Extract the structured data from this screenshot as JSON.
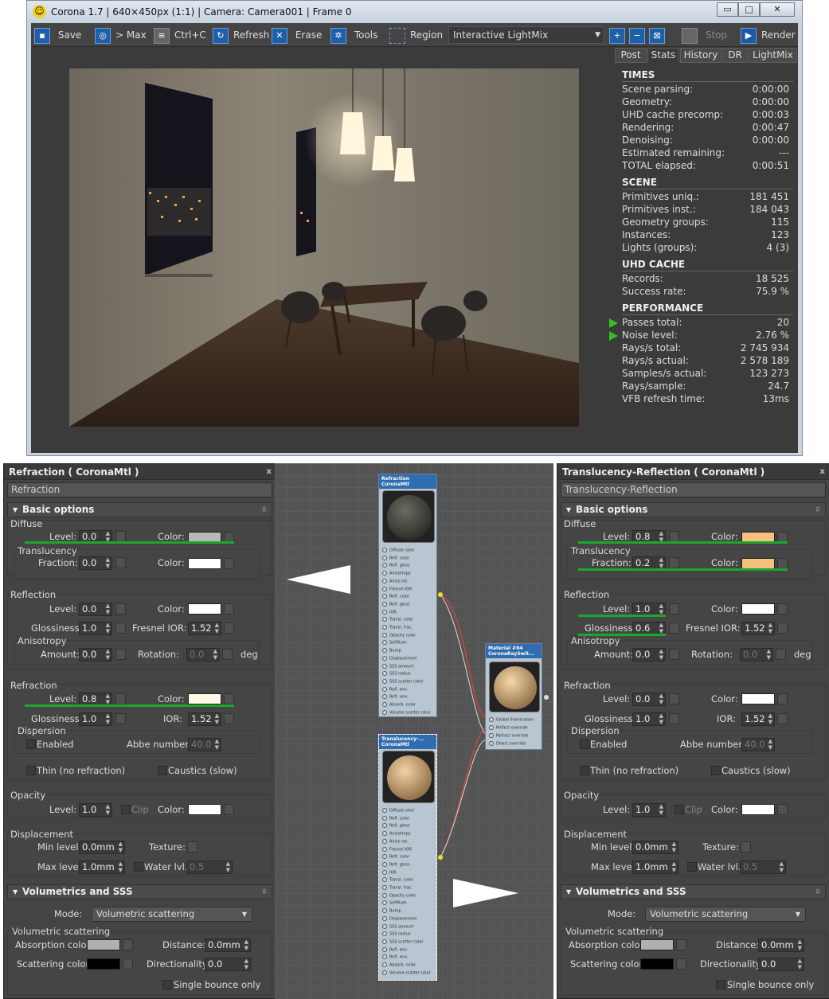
{
  "vfb": {
    "title": "Corona 1.7 | 640×450px (1:1) | Camera: Camera001 | Frame 0",
    "window_buttons": [
      "▭",
      "□",
      "✕"
    ],
    "toolbar": {
      "save": "Save",
      "max": "> Max",
      "copy": "Ctrl+C",
      "refresh": "Refresh",
      "erase": "Erase",
      "tools": "Tools",
      "region": "Region",
      "lightmix": "Interactive LightMix",
      "stop": "Stop",
      "render": "Render"
    },
    "tabs": [
      "Post",
      "Stats",
      "History",
      "DR",
      "LightMix"
    ],
    "active_tab": "Stats",
    "stats": {
      "times": {
        "heading": "TIMES",
        "rows": [
          {
            "label": "Scene parsing:",
            "value": "0:00:00"
          },
          {
            "label": "Geometry:",
            "value": "0:00:00"
          },
          {
            "label": "UHD cache precomp:",
            "value": "0:00:03"
          },
          {
            "label": "Rendering:",
            "value": "0:00:47"
          },
          {
            "label": "Denoising:",
            "value": "0:00:00"
          },
          {
            "label": "Estimated remaining:",
            "value": "---"
          },
          {
            "label": "TOTAL elapsed:",
            "value": "0:00:51"
          }
        ]
      },
      "scene": {
        "heading": "SCENE",
        "rows": [
          {
            "label": "Primitives uniq.:",
            "value": "181 451"
          },
          {
            "label": "Primitives inst.:",
            "value": "184 043"
          },
          {
            "label": "Geometry groups:",
            "value": "115"
          },
          {
            "label": "Instances:",
            "value": "123"
          },
          {
            "label": "Lights (groups):",
            "value": "4 (3)"
          }
        ]
      },
      "uhd": {
        "heading": "UHD CACHE",
        "rows": [
          {
            "label": "Records:",
            "value": "18 525"
          },
          {
            "label": "Success rate:",
            "value": "75.9 %"
          }
        ]
      },
      "performance": {
        "heading": "PERFORMANCE",
        "rows": [
          {
            "label": "Passes total:",
            "value": "20"
          },
          {
            "label": "Noise level:",
            "value": "2.76 %"
          },
          {
            "label": "Rays/s total:",
            "value": "2 745 934"
          },
          {
            "label": "Rays/s actual:",
            "value": "2 578 189"
          },
          {
            "label": "Samples/s actual:",
            "value": "123 273"
          },
          {
            "label": "Rays/sample:",
            "value": "24.7"
          },
          {
            "label": "VFB refresh time:",
            "value": "13ms"
          }
        ]
      }
    }
  },
  "left_panel": {
    "title": "Refraction  ( CoronaMtl )",
    "close": "x",
    "name": "Refraction",
    "basic": "Basic options",
    "diffuse": {
      "head": "Diffuse",
      "level_label": "Level:",
      "level": "0.0",
      "color_label": "Color:",
      "color": "#b8b8b8"
    },
    "translucency": {
      "head": "Translucency",
      "fraction_label": "Fraction:",
      "fraction": "0.0",
      "color_label": "Color:",
      "color": "#ffffff"
    },
    "reflection": {
      "head": "Reflection",
      "level_label": "Level:",
      "level": "0.0",
      "color_label": "Color:",
      "color": "#ffffff",
      "gloss_label": "Glossiness:",
      "gloss": "1.0",
      "ior_label": "Fresnel IOR:",
      "ior": "1.52"
    },
    "anisotropy": {
      "head": "Anisotropy",
      "amount_label": "Amount:",
      "amount": "0.0",
      "rotation_label": "Rotation:",
      "rotation": "0.0",
      "unit": "deg"
    },
    "refraction": {
      "head": "Refraction",
      "level_label": "Level:",
      "level": "0.8",
      "color_label": "Color:",
      "color": "#fff8e6",
      "gloss_label": "Glossiness:",
      "gloss": "1.0",
      "ior_label": "IOR:",
      "ior": "1.52"
    },
    "dispersion": {
      "head": "Dispersion",
      "enabled": "Enabled",
      "abbe_label": "Abbe number:",
      "abbe": "40.0"
    },
    "thin": "Thin (no refraction)",
    "caustics": "Caustics (slow)",
    "opacity": {
      "head": "Opacity",
      "level_label": "Level:",
      "level": "1.0",
      "clip": "Clip",
      "color_label": "Color:",
      "color": "#ffffff"
    },
    "displacement": {
      "head": "Displacement",
      "min_label": "Min level:",
      "min": "0.0mm",
      "texture_label": "Texture:",
      "max_label": "Max level:",
      "max": "1.0mm",
      "water_label": "Water lvl.:",
      "water": "0.5"
    },
    "vol": "Volumetrics and SSS",
    "mode_label": "Mode:",
    "mode": "Volumetric scattering",
    "volscat": {
      "head": "Volumetric scattering",
      "abs_label": "Absorption color:",
      "abs_color": "#b0b0b0",
      "dist_label": "Distance:",
      "dist": "0.0mm",
      "scat_label": "Scattering color:",
      "scat_color": "#000000",
      "dir_label": "Directionality:",
      "dir": "0.0",
      "single": "Single bounce only"
    }
  },
  "right_panel": {
    "title": "Translucency-Reflection  ( CoronaMtl )",
    "close": "x",
    "name": "Translucency-Reflection",
    "basic": "Basic options",
    "diffuse": {
      "head": "Diffuse",
      "level_label": "Level:",
      "level": "0.8",
      "color_label": "Color:",
      "color": "#f6c07e"
    },
    "translucency": {
      "head": "Translucency",
      "fraction_label": "Fraction:",
      "fraction": "0.2",
      "color_label": "Color:",
      "color": "#f6c07e"
    },
    "reflection": {
      "head": "Reflection",
      "level_label": "Level:",
      "level": "1.0",
      "color_label": "Color:",
      "color": "#ffffff",
      "gloss_label": "Glossiness:",
      "gloss": "0.6",
      "ior_label": "Fresnel IOR:",
      "ior": "1.52"
    },
    "anisotropy": {
      "head": "Anisotropy",
      "amount_label": "Amount:",
      "amount": "0.0",
      "rotation_label": "Rotation:",
      "rotation": "0.0",
      "unit": "deg"
    },
    "refraction": {
      "head": "Refraction",
      "level_label": "Level:",
      "level": "0.0",
      "color_label": "Color:",
      "color": "#ffffff",
      "gloss_label": "Glossiness:",
      "gloss": "1.0",
      "ior_label": "IOR:",
      "ior": "1.52"
    },
    "dispersion": {
      "head": "Dispersion",
      "enabled": "Enabled",
      "abbe_label": "Abbe number:",
      "abbe": "40.0"
    },
    "thin": "Thin (no refraction)",
    "caustics": "Caustics (slow)",
    "opacity": {
      "head": "Opacity",
      "level_label": "Level:",
      "level": "1.0",
      "clip": "Clip",
      "color_label": "Color:",
      "color": "#ffffff"
    },
    "displacement": {
      "head": "Displacement",
      "min_label": "Min level:",
      "min": "0.0mm",
      "texture_label": "Texture:",
      "max_label": "Max level:",
      "max": "1.0mm",
      "water_label": "Water lvl.:",
      "water": "0.5"
    },
    "vol": "Volumetrics and SSS",
    "mode_label": "Mode:",
    "mode": "Volumetric scattering",
    "volscat": {
      "head": "Volumetric scattering",
      "abs_label": "Absorption color:",
      "abs_color": "#b0b0b0",
      "dist_label": "Distance:",
      "dist": "0.0mm",
      "scat_label": "Scattering color:",
      "scat_color": "#000000",
      "dir_label": "Directionality:",
      "dir": "0.0",
      "single": "Single bounce only"
    }
  },
  "nodes": {
    "refraction": {
      "title1": "Refraction",
      "title2": "CoronaMtl"
    },
    "translucency": {
      "title1": "Translucency-...",
      "title2": "CoronaMtl"
    },
    "switch": {
      "title1": "Material #64",
      "title2": "CoronaRaySwit..."
    },
    "slots": [
      "Diffuse color",
      "Refl. color",
      "Refl. gloss",
      "Anisotropy",
      "Aniso rot.",
      "Fresnel IOR",
      "Refr. color",
      "Refr. gloss",
      "IOR",
      "Transl. color",
      "Transl. frac.",
      "Opacity color",
      "Selfillum",
      "Bump",
      "Displacement",
      "SSS amount",
      "SSS radius",
      "SSS scatter color",
      "Refl. env.",
      "Refr. env.",
      "Absorb. color",
      "Volume scatter color"
    ],
    "switch_slots": [
      "Global illumination",
      "Reflect override",
      "Refract override",
      "Direct override"
    ]
  }
}
